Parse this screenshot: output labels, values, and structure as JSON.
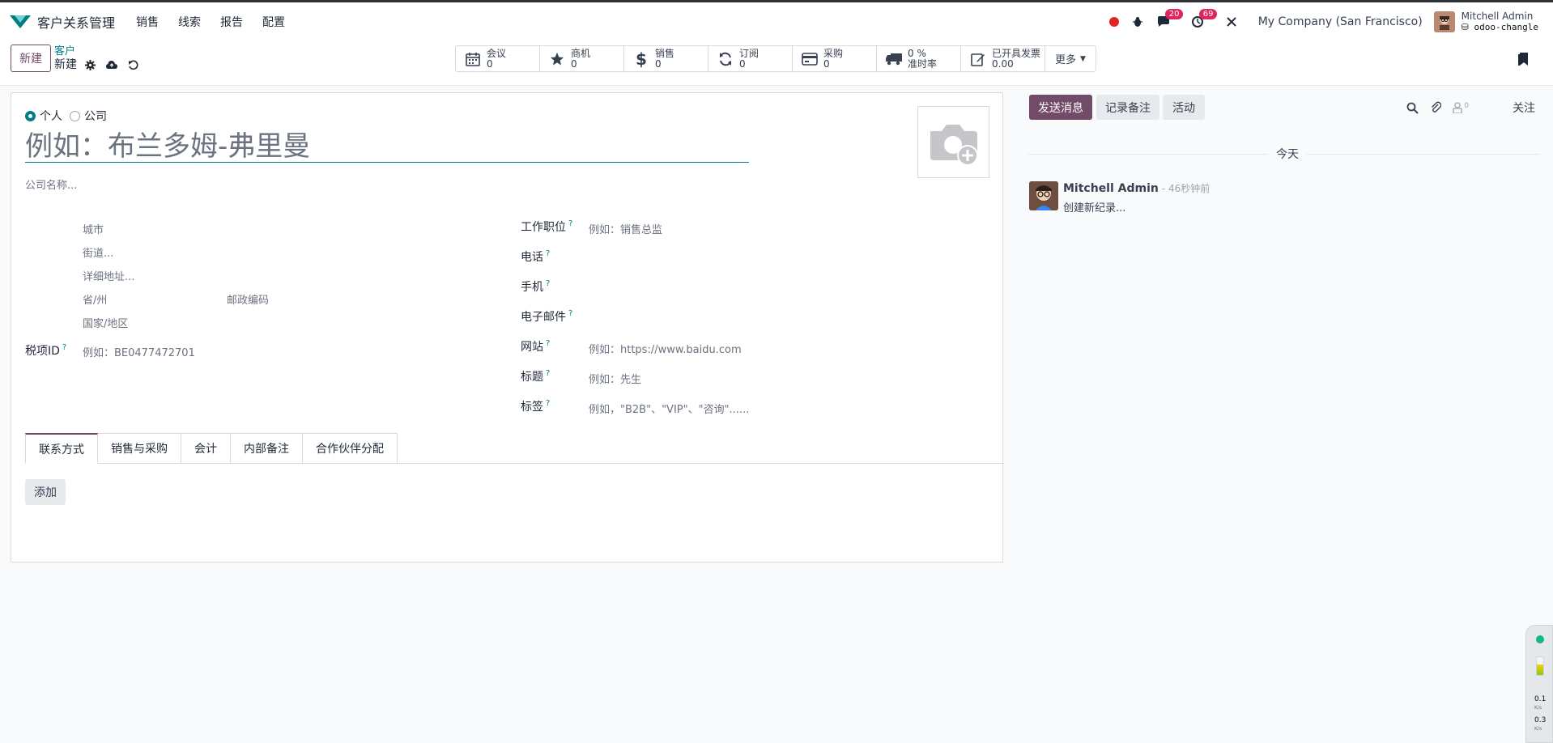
{
  "app": {
    "title": "客户关系管理",
    "nav": [
      "销售",
      "线索",
      "报告",
      "配置"
    ]
  },
  "systray": {
    "messages_count": "20",
    "activities_count": "69",
    "company": "My Company (San Francisco)",
    "user_name": "Mitchell Admin",
    "db_name": "odoo-changle"
  },
  "control": {
    "new_button": "新建",
    "breadcrumb_parent": "客户",
    "breadcrumb_current": "新建",
    "smart_buttons": [
      {
        "icon": "calendar-icon",
        "label": "会议",
        "value": "0"
      },
      {
        "icon": "star-icon",
        "label": "商机",
        "value": "0"
      },
      {
        "icon": "dollar-icon",
        "label": "销售",
        "value": "0"
      },
      {
        "icon": "refresh-icon",
        "label": "订阅",
        "value": "0"
      },
      {
        "icon": "credit-card-icon",
        "label": "采购",
        "value": "0"
      },
      {
        "icon": "truck-icon",
        "label": "0 %",
        "value": "准时率"
      },
      {
        "icon": "edit-icon",
        "label": "已开具发票",
        "value": "0.00"
      }
    ],
    "more_label": "更多"
  },
  "form": {
    "type_options": [
      "个人",
      "公司"
    ],
    "selected_type": "个人",
    "name_placeholder": "例如：布兰多姆-弗里曼",
    "company_placeholder": "公司名称...",
    "address": {
      "city": "城市",
      "street": "街道...",
      "street2": "详细地址...",
      "state": "省/州",
      "zip": "邮政编码",
      "country": "国家/地区"
    },
    "vat_label": "税项ID",
    "vat_placeholder": "例如：BE0477472701",
    "right_fields": [
      {
        "label": "工作职位",
        "placeholder": "例如：销售总监"
      },
      {
        "label": "电话",
        "placeholder": ""
      },
      {
        "label": "手机",
        "placeholder": ""
      },
      {
        "label": "电子邮件",
        "placeholder": ""
      },
      {
        "label": "网站",
        "placeholder": "例如：https://www.baidu.com"
      },
      {
        "label": "标题",
        "placeholder": "例如：先生"
      },
      {
        "label": "标签",
        "placeholder": "例如，\"B2B\"、\"VIP\"、\"咨询\"......"
      }
    ],
    "help_mark": "?",
    "tabs": [
      "联系方式",
      "销售与采购",
      "会计",
      "内部备注",
      "合作伙伴分配"
    ],
    "add_button": "添加"
  },
  "chatter": {
    "send_message": "发送消息",
    "log_note": "记录备注",
    "activity": "活动",
    "followers_count": "0",
    "follow": "关注",
    "date_separator": "今天",
    "message": {
      "author": "Mitchell Admin",
      "time": "- 46秒钟前",
      "body": "创建新纪录..."
    }
  },
  "monitor": {
    "up": "0.1",
    "down": "0.3",
    "unit": "K/s"
  },
  "colors": {
    "primary": "#714b67",
    "accent": "#017e84",
    "badge": "#e0245e"
  }
}
